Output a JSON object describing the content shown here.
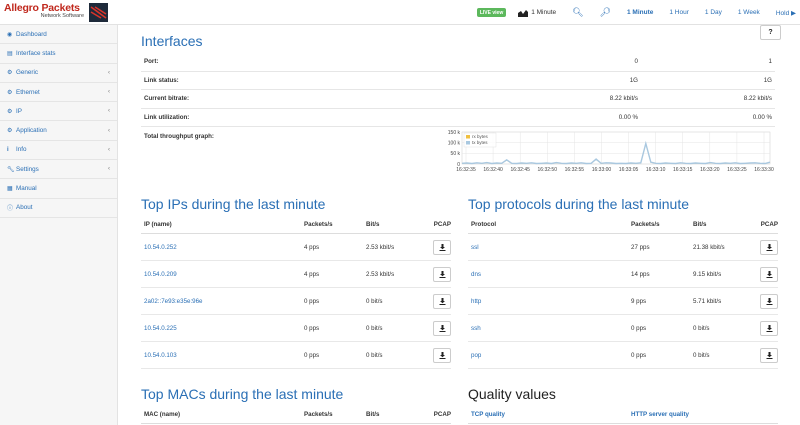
{
  "brand": {
    "title": "Allegro Packets",
    "subtitle": "Network Software"
  },
  "topnav": {
    "live_badge": "LIVE view",
    "interval_label": "1 Minute",
    "ranges": [
      "1 Minute",
      "1 Hour",
      "1 Day",
      "1 Week"
    ],
    "active_range": "1 Minute",
    "hold_label": "Hold"
  },
  "sidebar": {
    "items": [
      {
        "label": "Dashboard",
        "icon": "dashboard-icon",
        "has_children": false
      },
      {
        "label": "Interface stats",
        "icon": "chart-icon",
        "has_children": false
      },
      {
        "label": "Generic",
        "icon": "gear-icon",
        "has_children": true
      },
      {
        "label": "Ethernet",
        "icon": "gear-icon",
        "has_children": true
      },
      {
        "label": "IP",
        "icon": "gear-icon",
        "has_children": true
      },
      {
        "label": "Application",
        "icon": "gear-icon",
        "has_children": true
      },
      {
        "label": "Info",
        "icon": "info-icon",
        "has_children": true
      },
      {
        "label": "Settings",
        "icon": "wrench-icon",
        "has_children": true
      },
      {
        "label": "Manual",
        "icon": "book-icon",
        "has_children": false
      },
      {
        "label": "About",
        "icon": "info-circle-icon",
        "has_children": false
      }
    ]
  },
  "help_label": "?",
  "interfaces": {
    "title": "Interfaces",
    "rows": [
      {
        "label": "Port:",
        "v1": "0",
        "v2": "1"
      },
      {
        "label": "Link status:",
        "v1": "1G",
        "v2": "1G"
      },
      {
        "label": "Current bitrate:",
        "v1": "8.22 kbit/s",
        "v2": "8.22 kbit/s"
      },
      {
        "label": "Link utilization:",
        "v1": "0.00 %",
        "v2": "0.00 %"
      }
    ],
    "graph_label": "Total throughput graph:"
  },
  "chart_data": {
    "type": "line",
    "title": "",
    "xlabel": "",
    "ylabel": "",
    "y_tick_labels": [
      "0",
      "50 k",
      "100 k",
      "150 k"
    ],
    "ylim": [
      0,
      150000
    ],
    "x_tick_labels": [
      "16:32:35",
      "16:32:40",
      "16:32:45",
      "16:32:50",
      "16:32:55",
      "16:33:00",
      "16:33:05",
      "16:33:10",
      "16:33:15",
      "16:33:20",
      "16:33:25",
      "16:33:30"
    ],
    "legend_position": "top-left",
    "grid": true,
    "series": [
      {
        "name": "rx bytes",
        "color": "#f0c040",
        "values": [
          3000,
          4000,
          2000,
          5000,
          3000,
          6000,
          2000,
          4000,
          3000,
          18000,
          3000,
          2000,
          4000,
          3000,
          5000,
          2000,
          3000,
          4000,
          2000,
          6000,
          3000,
          2000,
          4000,
          3000,
          5000,
          2000,
          3000,
          22000,
          3000,
          5000,
          4000,
          2000,
          3000,
          2000,
          4000,
          3000,
          5000,
          95000,
          8000,
          3000,
          2000,
          4000,
          3000,
          2000,
          5000,
          3000,
          2000,
          4000,
          3000,
          2000,
          6000,
          3000,
          2000,
          4000,
          3000,
          5000,
          2000,
          3000,
          4000,
          5000,
          3000,
          2000,
          8000
        ]
      },
      {
        "name": "tx bytes",
        "color": "#a9c8e0",
        "values": [
          3500,
          4500,
          2500,
          5500,
          3500,
          6500,
          2500,
          4500,
          3500,
          19000,
          3500,
          2500,
          4500,
          3500,
          5500,
          2500,
          3500,
          4500,
          2500,
          6500,
          3500,
          2500,
          4500,
          3500,
          5500,
          2500,
          3500,
          23000,
          3500,
          5500,
          4500,
          2500,
          3500,
          2500,
          4500,
          3500,
          5500,
          96000,
          8500,
          3500,
          2500,
          4500,
          3500,
          2500,
          5500,
          3500,
          2500,
          4500,
          3500,
          2500,
          6500,
          3500,
          2500,
          4500,
          3500,
          5500,
          2500,
          3500,
          4500,
          5500,
          3500,
          2500,
          8500
        ]
      }
    ]
  },
  "top_ips": {
    "title": "Top IPs during the last minute",
    "headers": [
      "IP (name)",
      "Packets/s",
      "Bit/s",
      "PCAP"
    ],
    "rows": [
      {
        "name": "10.54.0.252",
        "pps": "4 pps",
        "bps": "2.53 kbit/s"
      },
      {
        "name": "10.54.0.209",
        "pps": "4 pps",
        "bps": "2.53 kbit/s"
      },
      {
        "name": "2a02::7e93:e35e:96e",
        "pps": "0 pps",
        "bps": "0 bit/s"
      },
      {
        "name": "10.54.0.225",
        "pps": "0 pps",
        "bps": "0 bit/s"
      },
      {
        "name": "10.54.0.103",
        "pps": "0 pps",
        "bps": "0 bit/s"
      }
    ]
  },
  "top_protocols": {
    "title": "Top protocols during the last minute",
    "headers": [
      "Protocol",
      "Packets/s",
      "Bit/s",
      "PCAP"
    ],
    "rows": [
      {
        "name": "ssl",
        "pps": "27 pps",
        "bps": "21.38 kbit/s"
      },
      {
        "name": "dns",
        "pps": "14 pps",
        "bps": "9.15 kbit/s"
      },
      {
        "name": "http",
        "pps": "9 pps",
        "bps": "5.71 kbit/s"
      },
      {
        "name": "ssh",
        "pps": "0 pps",
        "bps": "0 bit/s"
      },
      {
        "name": "pop",
        "pps": "0 pps",
        "bps": "0 bit/s"
      }
    ]
  },
  "top_macs": {
    "title": "Top MACs during the last minute",
    "headers": [
      "MAC (name)",
      "Packets/s",
      "Bit/s",
      "PCAP"
    ]
  },
  "quality": {
    "title": "Quality values",
    "tcp_label": "TCP quality",
    "http_label": "HTTP server quality"
  }
}
